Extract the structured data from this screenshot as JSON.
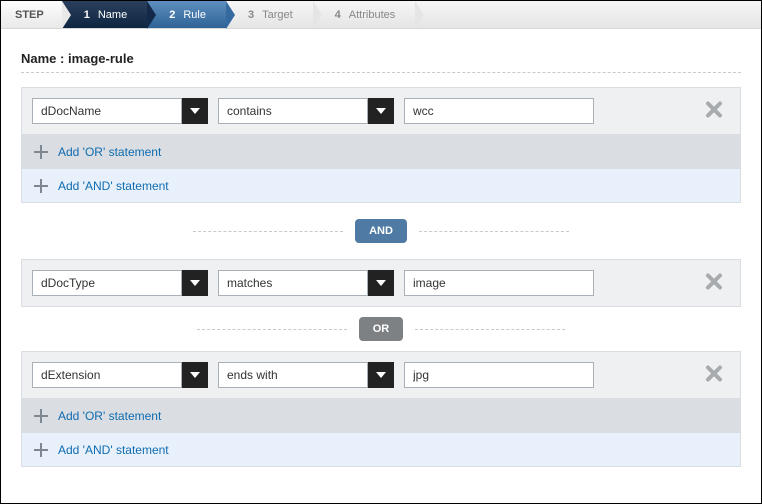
{
  "steps": {
    "label": "STEP",
    "items": [
      {
        "num": "1",
        "txt": "Name"
      },
      {
        "num": "2",
        "txt": "Rule"
      },
      {
        "num": "3",
        "txt": "Target"
      },
      {
        "num": "4",
        "txt": "Attributes"
      }
    ]
  },
  "rule_name_label": "Name : image-rule",
  "connector_and": "AND",
  "connector_or": "OR",
  "add_or_label": "Add 'OR' statement",
  "add_and_label": "Add 'AND' statement",
  "groups": [
    {
      "conditions": [
        {
          "field": "dDocName",
          "op": "contains",
          "value": "wcc"
        }
      ]
    },
    {
      "conditions": [
        {
          "field": "dDocType",
          "op": "matches",
          "value": "image"
        },
        {
          "field": "dExtension",
          "op": "ends with",
          "value": "jpg"
        }
      ]
    }
  ]
}
